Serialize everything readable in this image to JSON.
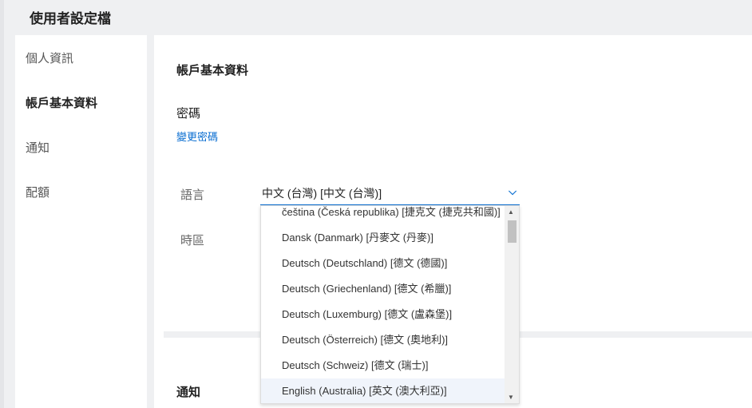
{
  "header": {
    "title": "使用者設定檔"
  },
  "sidebar": {
    "items": [
      {
        "label": "個人資訊"
      },
      {
        "label": "帳戶基本資料"
      },
      {
        "label": "通知"
      },
      {
        "label": "配額"
      }
    ]
  },
  "main": {
    "section_title": "帳戶基本資料",
    "password_label": "密碼",
    "change_password": "變更密碼",
    "language_label": "語言",
    "language_value": "中文 (台灣)  [中文 (台灣)]",
    "timezone_label": "時區",
    "notifications_title": "通知"
  },
  "dropdown": {
    "options": [
      "čeština (Česká republika) [捷克文 (捷克共和國)]",
      "Dansk (Danmark) [丹麥文 (丹麥)]",
      "Deutsch (Deutschland) [德文 (德國)]",
      "Deutsch (Griechenland) [德文 (希臘)]",
      "Deutsch (Luxemburg) [德文 (盧森堡)]",
      "Deutsch (Österreich) [德文 (奧地利)]",
      "Deutsch (Schweiz) [德文 (瑞士)]",
      "English (Australia) [英文 (澳大利亞)]"
    ],
    "highlighted_index": 7,
    "scroll_position": 0.05
  },
  "colors": {
    "accent": "#0a6ed1",
    "background": "#eff0f2"
  }
}
